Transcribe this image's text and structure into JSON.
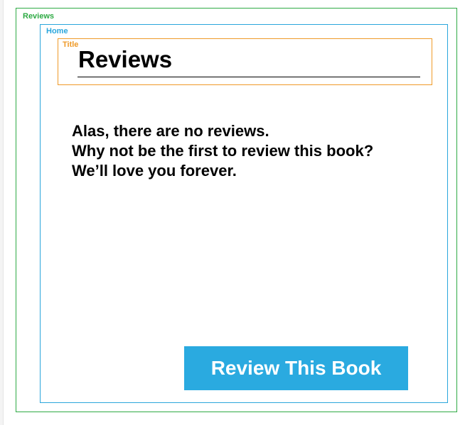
{
  "frames": {
    "reviews_label": "Reviews",
    "home_label": "Home",
    "title_label": "Title"
  },
  "title": {
    "text": "Reviews"
  },
  "empty_state": {
    "lines": [
      "Alas, there are no reviews.",
      "Why not be the first to review this book?",
      "We’ll love you forever."
    ]
  },
  "actions": {
    "review_button_label": "Review This Book"
  },
  "colors": {
    "reviews_frame": "#2eaa44",
    "home_frame": "#2aa6dc",
    "title_frame": "#ef9a28",
    "button_background": "#2aaae0",
    "button_text": "#ffffff"
  }
}
